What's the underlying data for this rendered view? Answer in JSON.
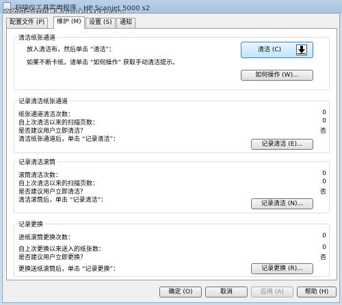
{
  "titlebar": {
    "title": "扫描仪工具实用程序 - HP Scanjet 5000 s2",
    "watermark": "你的门户 打印频道 print.it168.com"
  },
  "tabs": [
    {
      "label": "配置文件 (P)"
    },
    {
      "label": "维护 (M)"
    },
    {
      "label": "设置 (S)"
    },
    {
      "label": "通知"
    }
  ],
  "clean_paper_path": {
    "title": "清洁纸张通道",
    "instruction": "放入清洁布，然后单击 “清洁”：",
    "clean_button": "清洁 (C)",
    "help_text": "如果不断卡纸，请单击 “如何操作” 获取手动清洁提示。",
    "howto_button": "如何操作 (W)..."
  },
  "record_paper_path": {
    "title": "记录清洁纸张通道",
    "rows": [
      {
        "label": "纸张通道清洁次数：",
        "value": "0"
      },
      {
        "label": "自上次清洁以来的扫描页数：",
        "value": "0"
      },
      {
        "label": "是否建议用户立即清洁？",
        "value": "否"
      }
    ],
    "action_text": "清洁纸张通道后，单击 “记录清洁”：",
    "button": "记录清洁 (E)..."
  },
  "record_rollers": {
    "title": "记录清洁滚筒",
    "rows": [
      {
        "label": "滚筒清洁次数：",
        "value": "0"
      },
      {
        "label": "自上次清洁以来的扫描页数：",
        "value": "0"
      },
      {
        "label": "是否建议用户立即清洁？",
        "value": "否"
      }
    ],
    "action_text": "清洁滚筒后，单击 “记录清洁”：",
    "button": "记录清洁 (N)..."
  },
  "record_replacement": {
    "title": "记录更换",
    "rows": [
      {
        "label": "进纸滚筒更换次数：",
        "value": "0"
      },
      {
        "label": "自上次更换以来送入的纸张数：",
        "value": "0"
      },
      {
        "label": "是否建议用户立即更换？",
        "value": "否"
      }
    ],
    "action_text": "更换送纸滚筒后，单击 “记录更换”：",
    "button": "记录更换 (R)..."
  },
  "footer": {
    "ok": "确定 (O)",
    "cancel": "取消",
    "apply": "应用 (A)",
    "help": "帮助 (H)"
  }
}
